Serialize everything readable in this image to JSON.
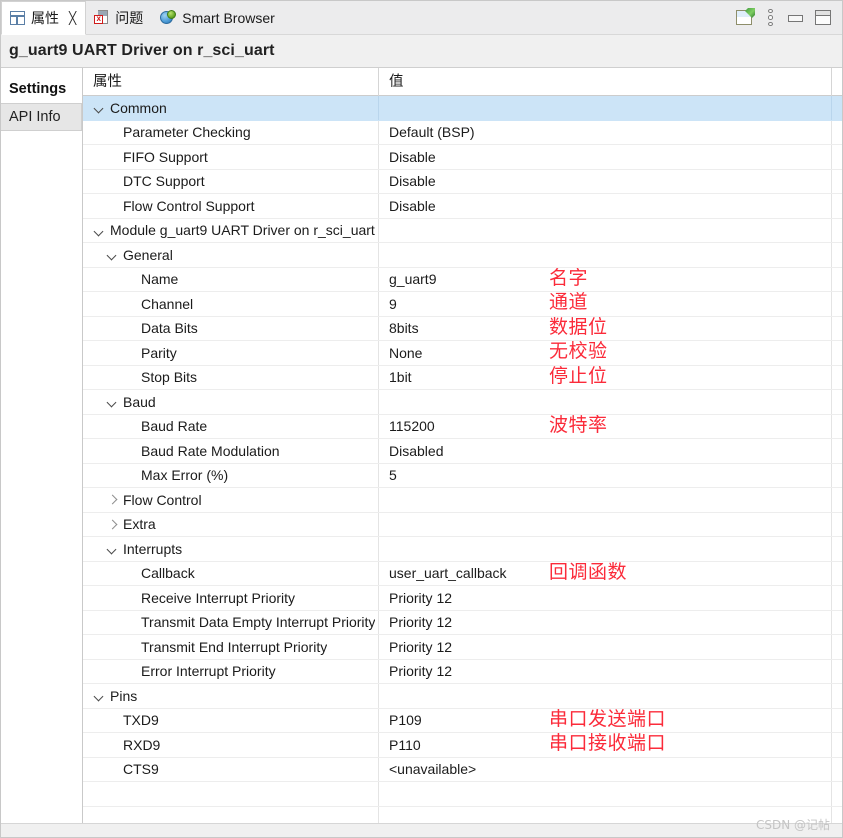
{
  "tabs": [
    {
      "label": "属性",
      "icon": "properties-icon",
      "active": true,
      "closable": true,
      "close_glyph": "╳"
    },
    {
      "label": "问题",
      "icon": "problems-icon",
      "active": false,
      "closable": false
    },
    {
      "label": "Smart Browser",
      "icon": "globe-icon",
      "active": false,
      "closable": false
    }
  ],
  "toolbar": {
    "pin": "pin-editor-icon",
    "menu": "view-menu-icon",
    "minimize": "minimize-icon",
    "maximize": "maximize-icon"
  },
  "title": "g_uart9 UART Driver on r_sci_uart",
  "sidebar": {
    "items": [
      {
        "label": "Settings",
        "active": true
      },
      {
        "label": "API Info",
        "active": false
      }
    ]
  },
  "table": {
    "headers": {
      "property": "属性",
      "value": "值"
    },
    "rows": [
      {
        "level": 0,
        "twisty": "down",
        "property": "Common",
        "value": "",
        "selected": true
      },
      {
        "level": 1,
        "twisty": "none",
        "property": "Parameter Checking",
        "value": "Default (BSP)"
      },
      {
        "level": 1,
        "twisty": "none",
        "property": "FIFO Support",
        "value": "Disable"
      },
      {
        "level": 1,
        "twisty": "none",
        "property": "DTC Support",
        "value": "Disable"
      },
      {
        "level": 1,
        "twisty": "none",
        "property": "Flow Control Support",
        "value": "Disable"
      },
      {
        "level": 0,
        "twisty": "down",
        "property": "Module g_uart9 UART Driver on r_sci_uart",
        "value": ""
      },
      {
        "level": 1,
        "twisty": "down",
        "property": "General",
        "value": ""
      },
      {
        "level": 2,
        "twisty": "none",
        "property": "Name",
        "value": "g_uart9",
        "note": "名字"
      },
      {
        "level": 2,
        "twisty": "none",
        "property": "Channel",
        "value": "9",
        "note": "通道"
      },
      {
        "level": 2,
        "twisty": "none",
        "property": "Data Bits",
        "value": "8bits",
        "note": "数据位"
      },
      {
        "level": 2,
        "twisty": "none",
        "property": "Parity",
        "value": "None",
        "note": "无校验"
      },
      {
        "level": 2,
        "twisty": "none",
        "property": "Stop Bits",
        "value": "1bit",
        "note": "停止位"
      },
      {
        "level": 1,
        "twisty": "down",
        "property": "Baud",
        "value": ""
      },
      {
        "level": 2,
        "twisty": "none",
        "property": "Baud Rate",
        "value": "115200",
        "note": "波特率"
      },
      {
        "level": 2,
        "twisty": "none",
        "property": "Baud Rate Modulation",
        "value": "Disabled"
      },
      {
        "level": 2,
        "twisty": "none",
        "property": "Max Error (%)",
        "value": "5"
      },
      {
        "level": 1,
        "twisty": "right",
        "property": "Flow Control",
        "value": ""
      },
      {
        "level": 1,
        "twisty": "right",
        "property": "Extra",
        "value": ""
      },
      {
        "level": 1,
        "twisty": "down",
        "property": "Interrupts",
        "value": ""
      },
      {
        "level": 2,
        "twisty": "none",
        "property": "Callback",
        "value": "user_uart_callback",
        "note": "回调函数"
      },
      {
        "level": 2,
        "twisty": "none",
        "property": "Receive Interrupt Priority",
        "value": "Priority 12"
      },
      {
        "level": 2,
        "twisty": "none",
        "property": "Transmit Data Empty Interrupt Priority",
        "value": "Priority 12"
      },
      {
        "level": 2,
        "twisty": "none",
        "property": "Transmit End Interrupt Priority",
        "value": "Priority 12"
      },
      {
        "level": 2,
        "twisty": "none",
        "property": "Error Interrupt Priority",
        "value": "Priority 12"
      },
      {
        "level": 0,
        "twisty": "down",
        "property": "Pins",
        "value": ""
      },
      {
        "level": 1,
        "twisty": "none",
        "property": "TXD9",
        "value": "P109",
        "note": "串口发送端口"
      },
      {
        "level": 1,
        "twisty": "none",
        "property": "RXD9",
        "value": "P110",
        "note": "串口接收端口"
      },
      {
        "level": 1,
        "twisty": "none",
        "property": "CTS9",
        "value": "<unavailable>"
      },
      {
        "level": 0,
        "twisty": "none",
        "property": "",
        "value": ""
      },
      {
        "level": 0,
        "twisty": "none",
        "property": "",
        "value": ""
      }
    ]
  },
  "watermark": "CSDN @记帖",
  "colors": {
    "selection": "#cce4f7",
    "annotation": "#fb2b3a",
    "chrome": "#f0f0f0"
  }
}
